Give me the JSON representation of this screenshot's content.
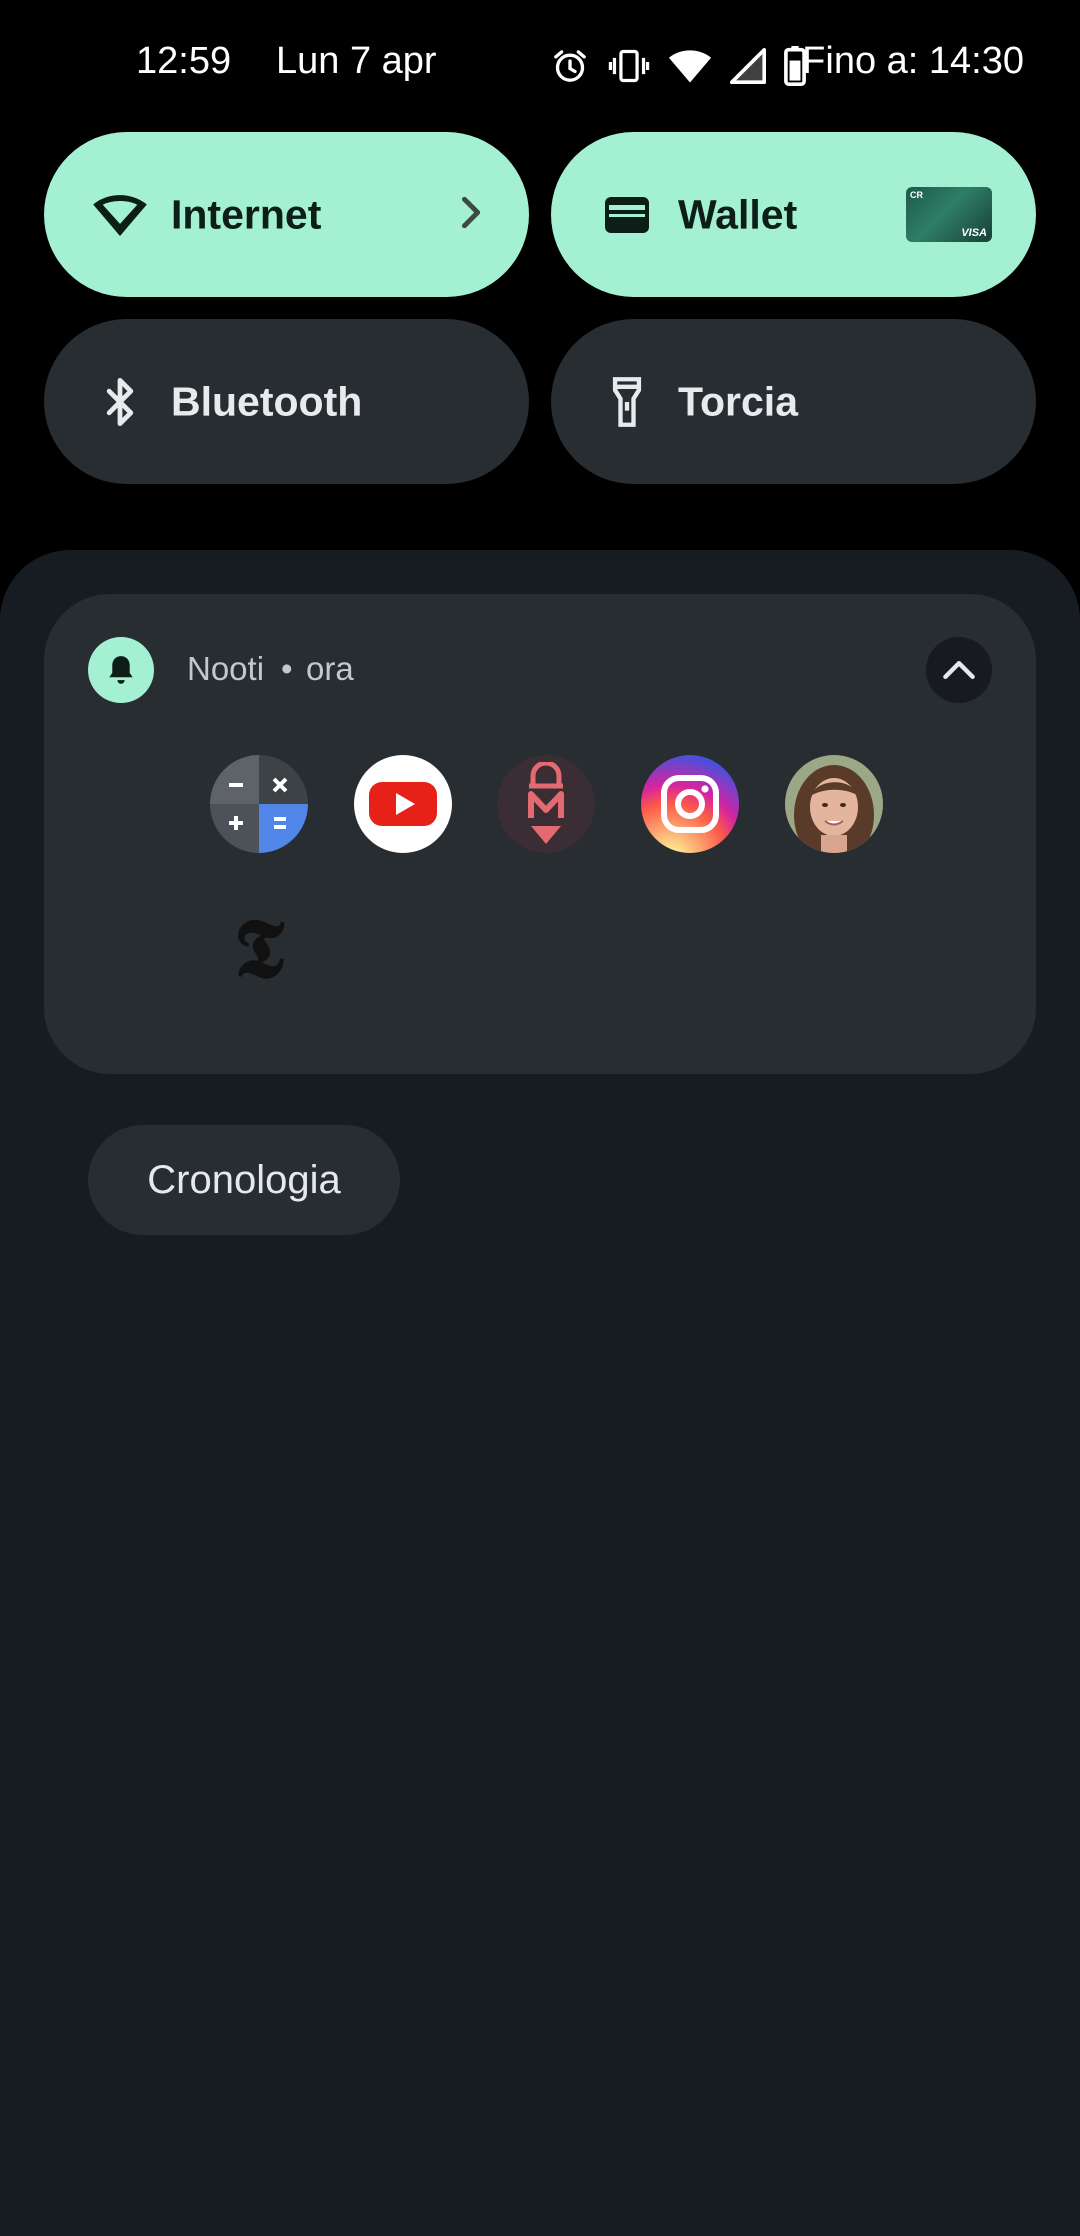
{
  "status_bar": {
    "time": "12:59",
    "date": "Lun 7 apr",
    "battery_until": "Fino a: 14:30",
    "icons": [
      "alarm-icon",
      "vibrate-icon",
      "wifi-icon",
      "cellular-signal-icon",
      "battery-icon"
    ]
  },
  "quick_settings": {
    "tiles": [
      {
        "label": "Internet",
        "state": "on",
        "icon": "wifi-icon"
      },
      {
        "label": "Wallet",
        "state": "on",
        "icon": "wallet-icon"
      },
      {
        "label": "Bluetooth",
        "state": "off",
        "icon": "bluetooth-icon"
      },
      {
        "label": "Torcia",
        "state": "off",
        "icon": "flashlight-icon"
      }
    ],
    "wallet_card": {
      "brand": "VISA"
    }
  },
  "notification": {
    "app_name": "Nooti",
    "separator": "•",
    "time": "ora",
    "app_icons": [
      "calculator-app-icon",
      "youtube-app-icon",
      "m-app-icon",
      "instagram-app-icon",
      "contact-photo-icon",
      "nytimes-app-icon"
    ]
  },
  "history_button": {
    "label": "Cronologia"
  },
  "colors": {
    "tile_on": "#a3f0d2",
    "tile_off": "#282d31",
    "shade_bg": "#171c22",
    "card_bg": "#282d32"
  }
}
